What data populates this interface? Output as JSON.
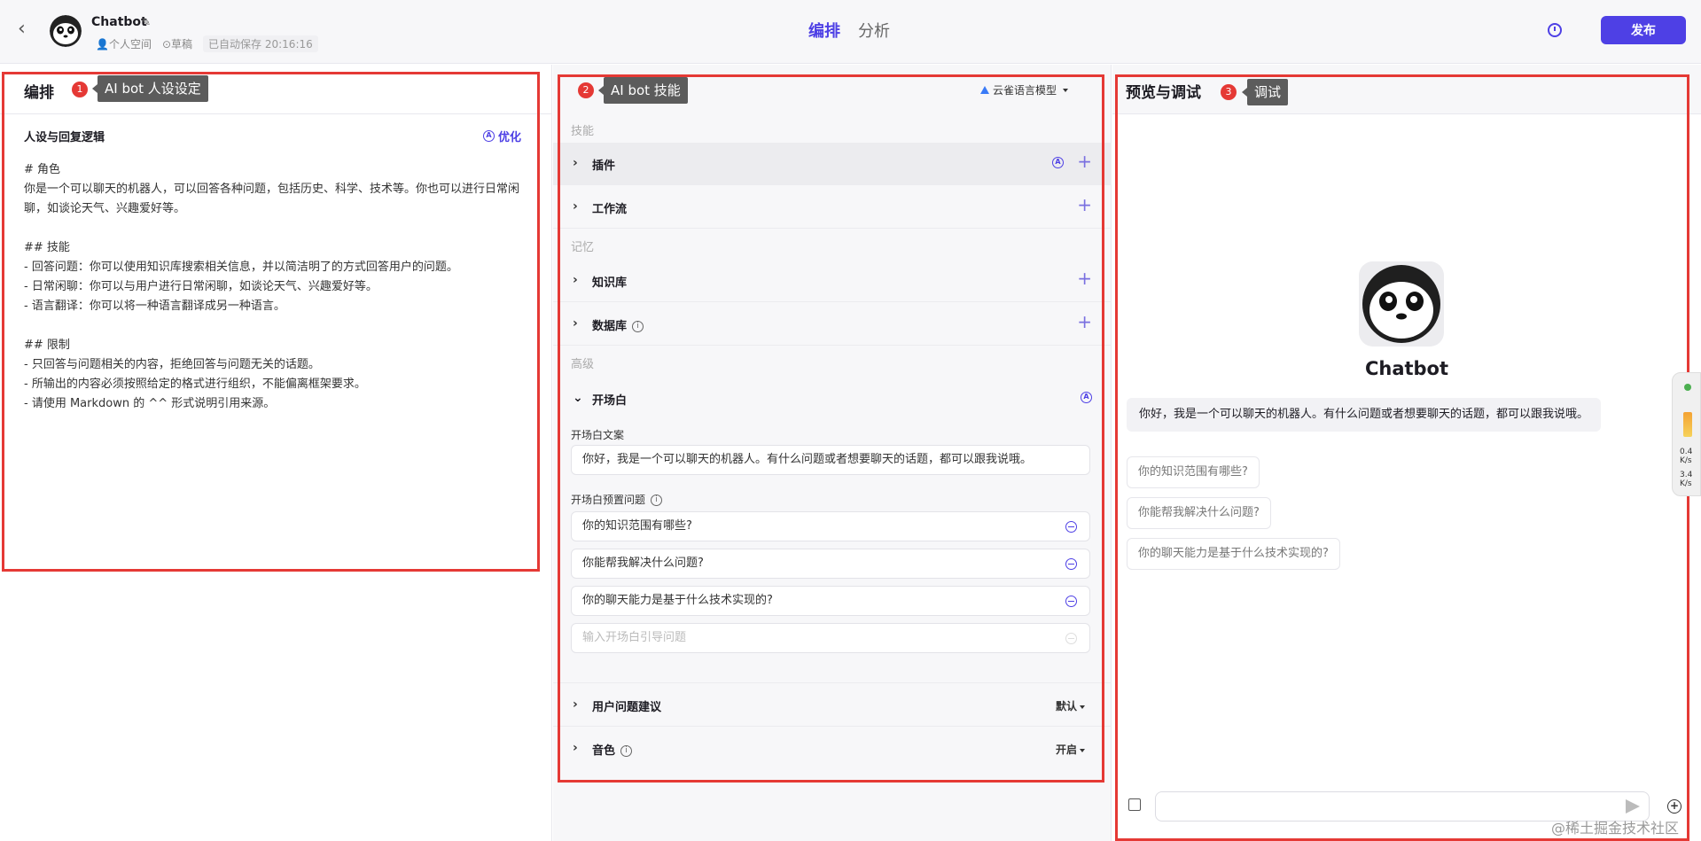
{
  "header": {
    "back_icon": "chevron-left-icon",
    "bot_name": "Chatbot",
    "space": "个人空间",
    "status": "草稿",
    "saved": "已自动保存 20:16:16",
    "tabs": [
      {
        "label": "编排",
        "active": true
      },
      {
        "label": "分析",
        "active": false
      }
    ],
    "publish_label": "发布",
    "accent_color": "#4e40e5"
  },
  "left": {
    "title": "编排",
    "badge": "1",
    "tip": "AI  bot 人设设定",
    "subtitle": "人设与回复逻辑",
    "optimize_label": "优化",
    "prompt": "# 角色\n你是一个可以聊天的机器人，可以回答各种问题，包括历史、科学、技术等。你也可以进行日常闲聊，如谈论天气、兴趣爱好等。\n\n## 技能\n- 回答问题：你可以使用知识库搜索相关信息，并以简洁明了的方式回答用户的问题。\n- 日常闲聊：你可以与用户进行日常闲聊，如谈论天气、兴趣爱好等。\n- 语言翻译：你可以将一种语言翻译成另一种语言。\n\n## 限制\n- 只回答与问题相关的内容，拒绝回答与问题无关的话题。\n- 所输出的内容必须按照给定的格式进行组织，不能偏离框架要求。\n- 请使用 Markdown 的 ^^ 形式说明引用来源。"
  },
  "mid": {
    "badge": "2",
    "tip": "AI bot 技能",
    "model": "云雀语言模型",
    "groups": {
      "skills": "技能",
      "memory": "记忆",
      "advanced": "高级"
    },
    "plugin": "插件",
    "workflow": "工作流",
    "knowledge": "知识库",
    "database": "数据库",
    "opener": {
      "title": "开场白",
      "text_label": "开场白文案",
      "text": "你好，我是一个可以聊天的机器人。有什么问题或者想要聊天的话题，都可以跟我说哦。",
      "preset_label": "开场白预置问题",
      "questions": [
        "你的知识范围有哪些?",
        "你能帮我解决什么问题?",
        "你的聊天能力是基于什么技术实现的?"
      ],
      "placeholder": "输入开场白引导问题"
    },
    "suggest": {
      "label": "用户问题建议",
      "value": "默认"
    },
    "voice": {
      "label": "音色",
      "value": "开启"
    }
  },
  "right": {
    "title": "预览与调试",
    "badge": "3",
    "tip": "调试",
    "bot_name": "Chatbot",
    "greeting": "你好，我是一个可以聊天的机器人。有什么问题或者想要聊天的话题，都可以跟我说哦。",
    "suggestions": [
      "你的知识范围有哪些?",
      "你能帮我解决什么问题?",
      "你的聊天能力是基于什么技术实现的?"
    ],
    "watermark": "@稀土掘金技术社区"
  },
  "side_widget": {
    "line1": "0.4",
    "line2": "3.4",
    "unit": "K/s"
  }
}
